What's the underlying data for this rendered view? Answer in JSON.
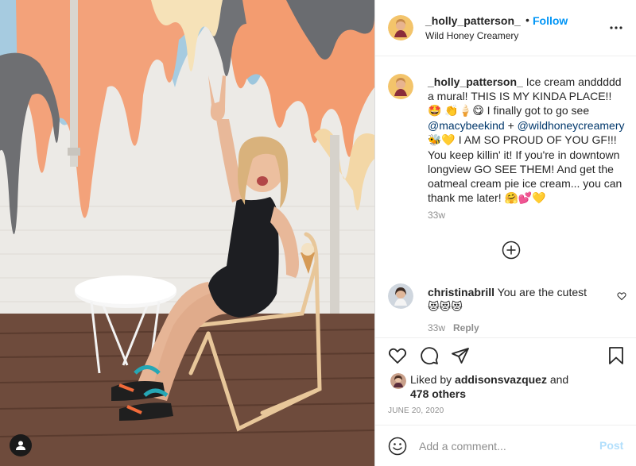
{
  "post": {
    "author": "_holly_patterson_",
    "separator": "•",
    "follow_label": "Follow",
    "location": "Wild Honey Creamery",
    "more_icon": "more-dots-icon"
  },
  "caption": {
    "username": "_holly_patterson_",
    "text_1": " Ice cream anddddd a mural! THIS IS MY KINDA PLACE!! ",
    "emoji_1": "🤩",
    "emoji_2": "👏🍦😋",
    "text_2": " I finally got to go see ",
    "mention_1": "@macybeekind",
    "text_3": " + ",
    "mention_2": "@wildhoneycreamery",
    "emoji_3": "🐝💛",
    "text_4": " I AM SO PROUD OF YOU GF!!! You keep killin' it! If you're in downtown longview GO SEE THEM! And get the oatmeal cream pie ice cream... you can thank me later! ",
    "emoji_4": "🤗💕💛",
    "time": "33w"
  },
  "comment": {
    "username": "christinabrill",
    "text": " You are the cutest",
    "emojis": "😻😻😻",
    "time": "33w",
    "reply_label": "Reply"
  },
  "likes": {
    "prefix": "Liked by ",
    "user": "addisonsvazquez",
    "middle": " and",
    "others": "478 others"
  },
  "date": "JUNE 20, 2020",
  "add_comment": {
    "placeholder": "Add a comment...",
    "post_label": "Post"
  },
  "colors": {
    "link": "#0095f6",
    "mention": "#00376b",
    "muted": "#8e8e8e",
    "post_disabled": "#b2dffc"
  }
}
